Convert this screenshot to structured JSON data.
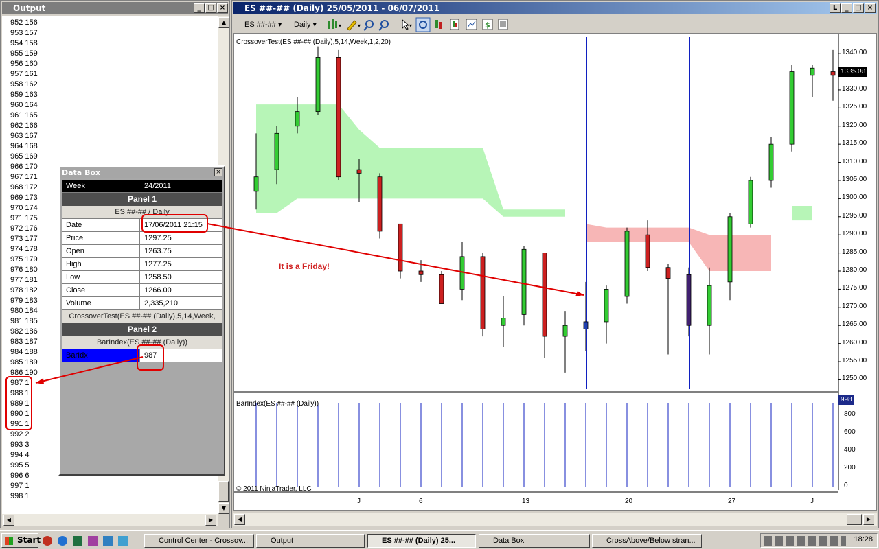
{
  "output_window": {
    "title": "Output",
    "lines": [
      "952 156",
      "953 157",
      "954 158",
      "955 159",
      "956 160",
      "957 161",
      "958 162",
      "959 163",
      "960 164",
      "961 165",
      "962 166",
      "963 167",
      "964 168",
      "965 169",
      "966 170",
      "967 171",
      "968 172",
      "969 173",
      "970 174",
      "971 175",
      "972 176",
      "973 177",
      "974 178",
      "975 179",
      "976 180",
      "977 181",
      "978 182",
      "979 183",
      "980 184",
      "981 185",
      "982 186",
      "983 187",
      "984 188",
      "985 189",
      "986 190",
      "987 1",
      "988 1",
      "989 1",
      "990 1",
      "991 1",
      "992 2",
      "993 3",
      "994 4",
      "995 5",
      "996 6",
      "997 1",
      "998 1"
    ]
  },
  "data_box": {
    "title": "Data Box",
    "week_label": "Week",
    "week_value": "24/2011",
    "panel1": "Panel 1",
    "panel1_sub": "ES ##-## / Daily",
    "rows": [
      {
        "k": "Date",
        "v": "17/06/2011 21:15"
      },
      {
        "k": "Price",
        "v": "1297.25"
      },
      {
        "k": "Open",
        "v": "1263.75"
      },
      {
        "k": "High",
        "v": "1277.25"
      },
      {
        "k": "Low",
        "v": "1258.50"
      },
      {
        "k": "Close",
        "v": "1266.00"
      },
      {
        "k": "Volume",
        "v": "2,335,210"
      }
    ],
    "crossover_label": "CrossoverTest(ES ##-## (Daily),5,14,Week,",
    "panel2": "Panel 2",
    "panel2_sub": "BarIndex(ES ##-## (Daily))",
    "barindex_label": "BarIdx",
    "barindex_value": "987"
  },
  "chart_window": {
    "title": "ES ##-## (Daily)  25/05/2011 - 06/07/2011",
    "instrument": "ES ##-##",
    "period": "Daily",
    "indicator_label": "CrossoverTest(ES ##-## (Daily),5,14,Week,1,2,20)",
    "barindex_label": "BarIndex(ES ##-## (Daily))",
    "copyright": "© 2011 NinjaTrader, LLC",
    "annotation": "It is a Friday!",
    "last_price": "1335.00",
    "last_barindex": "998",
    "price_ticks": [
      "1340.00",
      "1335.00",
      "1330.00",
      "1325.00",
      "1320.00",
      "1315.00",
      "1310.00",
      "1305.00",
      "1300.00",
      "1295.00",
      "1290.00",
      "1285.00",
      "1280.00",
      "1275.00",
      "1270.00",
      "1265.00",
      "1260.00",
      "1255.00",
      "1250.00"
    ],
    "bi_ticks": [
      "800",
      "600",
      "400",
      "200",
      "0"
    ],
    "date_ticks": [
      "J",
      "6",
      "13",
      "20",
      "27",
      "J"
    ]
  },
  "chart_data": {
    "type": "candlestick",
    "ylim": [
      1248,
      1344
    ],
    "candles": [
      {
        "o": 1302,
        "h": 1318,
        "l": 1297,
        "c": 1306,
        "col": "g"
      },
      {
        "o": 1308,
        "h": 1320,
        "l": 1304,
        "c": 1318,
        "col": "g"
      },
      {
        "o": 1320,
        "h": 1328,
        "l": 1318,
        "c": 1324,
        "col": "g"
      },
      {
        "o": 1324,
        "h": 1342,
        "l": 1323,
        "c": 1339,
        "col": "g"
      },
      {
        "o": 1339,
        "h": 1341,
        "l": 1305,
        "c": 1306,
        "col": "r"
      },
      {
        "o": 1308,
        "h": 1311,
        "l": 1299,
        "c": 1307,
        "col": "r"
      },
      {
        "o": 1306,
        "h": 1307,
        "l": 1289,
        "c": 1291,
        "col": "r"
      },
      {
        "o": 1293,
        "h": 1293,
        "l": 1278,
        "c": 1280,
        "col": "r"
      },
      {
        "o": 1280,
        "h": 1283,
        "l": 1277,
        "c": 1279,
        "col": "r"
      },
      {
        "o": 1279,
        "h": 1280,
        "l": 1271,
        "c": 1271,
        "col": "r"
      },
      {
        "o": 1275,
        "h": 1288,
        "l": 1272,
        "c": 1284,
        "col": "g"
      },
      {
        "o": 1284,
        "h": 1285,
        "l": 1262,
        "c": 1264,
        "col": "r"
      },
      {
        "o": 1265,
        "h": 1273,
        "l": 1259,
        "c": 1267,
        "col": "g"
      },
      {
        "o": 1268,
        "h": 1287,
        "l": 1265,
        "c": 1286,
        "col": "g"
      },
      {
        "o": 1285,
        "h": 1285,
        "l": 1256,
        "c": 1262,
        "col": "r"
      },
      {
        "o": 1262,
        "h": 1269,
        "l": 1252,
        "c": 1265,
        "col": "g"
      },
      {
        "o": 1264,
        "h": 1277,
        "l": 1258,
        "c": 1266,
        "col": "b"
      },
      {
        "o": 1266,
        "h": 1276,
        "l": 1260,
        "c": 1275,
        "col": "g"
      },
      {
        "o": 1273,
        "h": 1292,
        "l": 1271,
        "c": 1291,
        "col": "g"
      },
      {
        "o": 1290,
        "h": 1294,
        "l": 1280,
        "c": 1281,
        "col": "r"
      },
      {
        "o": 1281,
        "h": 1282,
        "l": 1257,
        "c": 1278,
        "col": "r"
      },
      {
        "o": 1279,
        "h": 1281,
        "l": 1262,
        "c": 1265,
        "col": "p"
      },
      {
        "o": 1265,
        "h": 1281,
        "l": 1257,
        "c": 1276,
        "col": "g"
      },
      {
        "o": 1277,
        "h": 1296,
        "l": 1272,
        "c": 1295,
        "col": "g"
      },
      {
        "o": 1293,
        "h": 1306,
        "l": 1292,
        "c": 1305,
        "col": "g"
      },
      {
        "o": 1305,
        "h": 1317,
        "l": 1303,
        "c": 1315,
        "col": "g"
      },
      {
        "o": 1315,
        "h": 1337,
        "l": 1313,
        "c": 1335,
        "col": "g"
      },
      {
        "o": 1334,
        "h": 1337,
        "l": 1328,
        "c": 1336,
        "col": "g"
      },
      {
        "o": 1335,
        "h": 1341,
        "l": 1327,
        "c": 1334,
        "col": "r"
      }
    ],
    "cloud_green_top": [
      1326,
      1326,
      1326,
      1326,
      1326,
      1319,
      1314,
      1314,
      1314,
      1314,
      1314,
      1314,
      1297,
      1297,
      1297,
      1297,
      null,
      null,
      null,
      null,
      null,
      null,
      null,
      null,
      null,
      null,
      1298,
      1298
    ],
    "cloud_green_bot": [
      1296,
      1296,
      1300,
      1300,
      1300,
      1300,
      1300,
      1300,
      1300,
      1300,
      1300,
      1300,
      1295,
      1295,
      1295,
      1295,
      null,
      null,
      null,
      null,
      null,
      null,
      null,
      null,
      null,
      null,
      1294,
      1294
    ],
    "cloud_red_top": [
      null,
      null,
      null,
      null,
      null,
      null,
      null,
      null,
      null,
      null,
      null,
      null,
      null,
      null,
      null,
      null,
      1293,
      1292,
      1292,
      1292,
      1292,
      1292,
      1290,
      1290,
      1290,
      1290,
      null,
      null
    ],
    "cloud_red_bot": [
      null,
      null,
      null,
      null,
      null,
      null,
      null,
      null,
      null,
      null,
      null,
      null,
      null,
      null,
      null,
      null,
      1288,
      1288,
      1288,
      1288,
      1288,
      1288,
      1280,
      1280,
      1280,
      1280,
      null,
      null
    ]
  },
  "taskbar": {
    "start": "Start",
    "buttons": [
      "Control Center - Crossov...",
      "Output",
      "ES ##-## (Daily)  25...",
      "Data Box",
      "CrossAbove/Below stran..."
    ],
    "clock": "18:28"
  }
}
